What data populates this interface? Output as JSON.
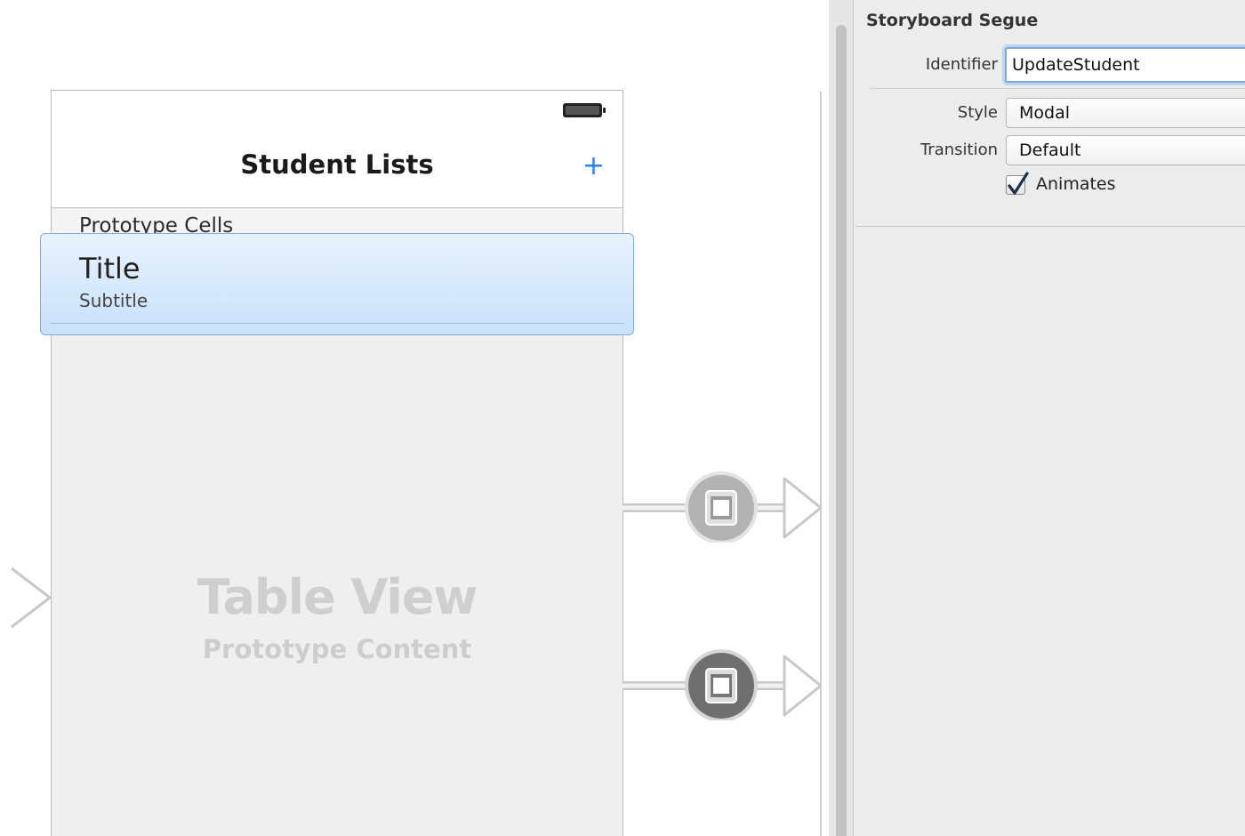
{
  "canvas": {
    "scene": {
      "nav_title": "Student Lists",
      "add_button": "+",
      "section_header": "Prototype Cells",
      "cell": {
        "title": "Title",
        "subtitle": "Subtitle"
      },
      "table_view_title": "Table View",
      "table_view_subtitle": "Prototype Content"
    },
    "segues": [
      {
        "style": "selected"
      },
      {
        "style": "unselected"
      }
    ]
  },
  "inspector": {
    "section_title": "Storyboard Segue",
    "identifier_label": "Identifier",
    "identifier_value": "UpdateStudent",
    "style_label": "Style",
    "style_value": "Modal",
    "transition_label": "Transition",
    "transition_value": "Default",
    "animates_label": "Animates",
    "animates_checked": true
  },
  "colors": {
    "tint": "#2f7ff3",
    "selection": "#c9e1fa",
    "inspector_bg": "#ececec"
  },
  "icons": [
    "battery-icon",
    "add-icon",
    "segue-modal-icon",
    "arrow-icon",
    "checkmark-icon"
  ]
}
